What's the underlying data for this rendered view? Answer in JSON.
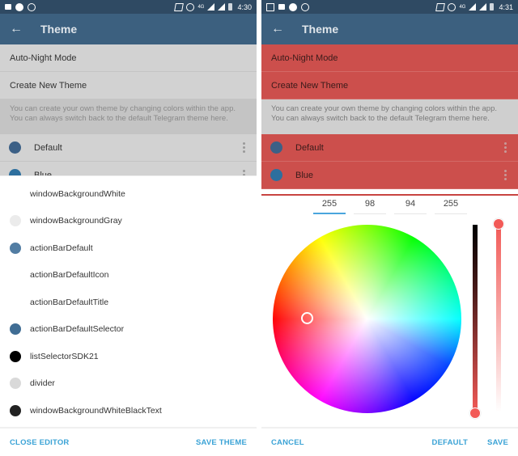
{
  "left": {
    "status": {
      "time": "4:30",
      "network": "4G"
    },
    "appbar": {
      "title": "Theme",
      "back_icon": "arrow-left"
    },
    "rows": [
      "Auto-Night Mode",
      "Create New Theme"
    ],
    "info": "You can create your own theme by changing colors within the app. You can always switch back to the default Telegram theme here.",
    "themes": [
      {
        "name": "Default",
        "color": "#3c6086"
      },
      {
        "name": "Blue",
        "color": "#2d6f9e"
      }
    ],
    "colors": [
      {
        "name": "windowBackgroundWhite",
        "color": "#ffffff"
      },
      {
        "name": "windowBackgroundGray",
        "color": "#ebebeb"
      },
      {
        "name": "actionBarDefault",
        "color": "#527da3"
      },
      {
        "name": "actionBarDefaultIcon",
        "color": "#ffffff"
      },
      {
        "name": "actionBarDefaultTitle",
        "color": "#ffffff"
      },
      {
        "name": "actionBarDefaultSelector",
        "color": "#406d94"
      },
      {
        "name": "listSelectorSDK21",
        "color": "#000000"
      },
      {
        "name": "divider",
        "color": "#d9d9d9"
      },
      {
        "name": "windowBackgroundWhiteBlackText",
        "color": "#222222"
      }
    ],
    "footer": {
      "close": "CLOSE EDITOR",
      "save": "SAVE THEME"
    }
  },
  "right": {
    "status": {
      "time": "4:31",
      "network": "4G"
    },
    "appbar": {
      "title": "Theme",
      "back_icon": "arrow-left"
    },
    "rows": [
      "Auto-Night Mode",
      "Create New Theme"
    ],
    "info": "You can create your own theme by changing colors within the app. You can always switch back to the default Telegram theme here.",
    "themes": [
      {
        "name": "Default",
        "color": "#3c6086"
      },
      {
        "name": "Blue",
        "color": "#2d6f9e"
      }
    ],
    "picker": {
      "r": "255",
      "g": "98",
      "b": "94",
      "a": "255",
      "selected_color": "#ff625e",
      "brightness": 1.0,
      "alpha": 1.0
    },
    "footer": {
      "cancel": "CANCEL",
      "default": "DEFAULT",
      "save": "SAVE"
    }
  },
  "accent": "#3ba3d6",
  "highlight": "#cc4f4c"
}
